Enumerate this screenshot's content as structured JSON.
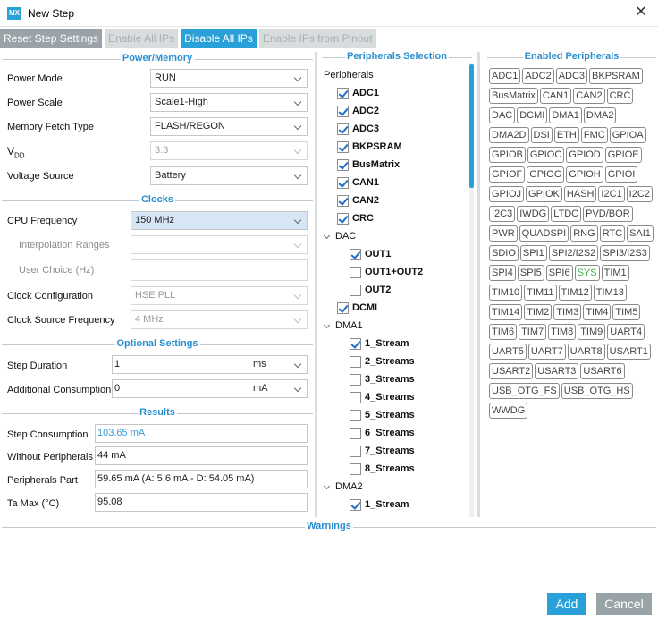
{
  "window": {
    "logo": "MX",
    "title": "New Step",
    "close": "✕"
  },
  "toolbar": {
    "reset": "Reset Step Settings",
    "enable_all": "Enable All IPs",
    "disable_all": "Disable All IPs",
    "enable_pinout": "Enable IPs from Pinout"
  },
  "power_memory": {
    "title": "Power/Memory",
    "power_mode_label": "Power Mode",
    "power_mode": "RUN",
    "power_scale_label": "Power Scale",
    "power_scale": "Scale1-High",
    "memory_fetch_label": "Memory Fetch Type",
    "memory_fetch": "FLASH/REGON",
    "vdd_label": "V",
    "vdd_sub": "DD",
    "vdd": "3.3",
    "voltage_source_label": "Voltage Source",
    "voltage_source": "Battery"
  },
  "clocks": {
    "title": "Clocks",
    "cpu_freq_label": "CPU Frequency",
    "cpu_freq": "150 MHz",
    "interp_label": "Interpolation Ranges",
    "user_choice_label": "User Choice (Hz)",
    "clock_config_label": "Clock Configuration",
    "clock_config": "HSE PLL",
    "clock_source_label": "Clock Source Frequency",
    "clock_source": "4 MHz"
  },
  "optional": {
    "title": "Optional Settings",
    "step_duration_label": "Step Duration",
    "step_duration": "1",
    "step_duration_unit": "ms",
    "additional_label": "Additional Consumption",
    "additional": "0",
    "additional_unit": "mA"
  },
  "results": {
    "title": "Results",
    "step_consumption_label": "Step Consumption",
    "step_consumption": "103.65 mA",
    "without_label": "Without Peripherals",
    "without": "44 mA",
    "peripherals_part_label": "Peripherals Part",
    "peripherals_part": "59.65 mA  (A: 5.6 mA - D: 54.05 mA)",
    "ta_max_label": "Ta Max (°C)",
    "ta_max": "95.08"
  },
  "peripherals_selection": {
    "title": "Peripherals Selection",
    "root": "Peripherals",
    "items": [
      {
        "label": "ADC1",
        "checked": true
      },
      {
        "label": "ADC2",
        "checked": true
      },
      {
        "label": "ADC3",
        "checked": true
      },
      {
        "label": "BKPSRAM",
        "checked": true
      },
      {
        "label": "BusMatrix",
        "checked": true
      },
      {
        "label": "CAN1",
        "checked": true
      },
      {
        "label": "CAN2",
        "checked": true
      },
      {
        "label": "CRC",
        "checked": true
      }
    ],
    "dac": {
      "label": "DAC",
      "items": [
        {
          "label": "OUT1",
          "checked": true
        },
        {
          "label": "OUT1+OUT2",
          "checked": false
        },
        {
          "label": "OUT2",
          "checked": false
        }
      ]
    },
    "dcmi": {
      "label": "DCMI",
      "checked": true
    },
    "dma1": {
      "label": "DMA1",
      "items": [
        {
          "label": "1_Stream",
          "checked": true
        },
        {
          "label": "2_Streams",
          "checked": false
        },
        {
          "label": "3_Streams",
          "checked": false
        },
        {
          "label": "4_Streams",
          "checked": false
        },
        {
          "label": "5_Streams",
          "checked": false
        },
        {
          "label": "6_Streams",
          "checked": false
        },
        {
          "label": "7_Streams",
          "checked": false
        },
        {
          "label": "8_Streams",
          "checked": false
        }
      ]
    },
    "dma2": {
      "label": "DMA2",
      "items": [
        {
          "label": "1_Stream",
          "checked": true
        }
      ]
    }
  },
  "enabled_peripherals": {
    "title": "Enabled Peripherals",
    "chips": [
      "ADC1",
      "ADC2",
      "ADC3",
      "BKPSRAM",
      "BusMatrix",
      "CAN1",
      "CAN2",
      "CRC",
      "DAC",
      "DCMI",
      "DMA1",
      "DMA2",
      "DMA2D",
      "DSI",
      "ETH",
      "FMC",
      "GPIOA",
      "GPIOB",
      "GPIOC",
      "GPIOD",
      "GPIOE",
      "GPIOF",
      "GPIOG",
      "GPIOH",
      "GPIOI",
      "GPIOJ",
      "GPIOK",
      "HASH",
      "I2C1",
      "I2C2",
      "I2C3",
      "IWDG",
      "LTDC",
      "PVD/BOR",
      "PWR",
      "QUADSPI",
      "RNG",
      "RTC",
      "SAI1",
      "SDIO",
      "SPI1",
      "SPI2/I2S2",
      "SPI3/I2S3",
      "SPI4",
      "SPI5",
      "SPI6",
      "SYS",
      "TIM1",
      "TIM10",
      "TIM11",
      "TIM12",
      "TIM13",
      "TIM14",
      "TIM2",
      "TIM3",
      "TIM4",
      "TIM5",
      "TIM6",
      "TIM7",
      "TIM8",
      "TIM9",
      "UART4",
      "UART5",
      "UART7",
      "UART8",
      "USART1",
      "USART2",
      "USART3",
      "USART6",
      "USB_OTG_FS",
      "USB_OTG_HS",
      "WWDG"
    ],
    "highlight_color": "#3db04a",
    "highlighted": "SYS"
  },
  "warnings": {
    "title": "Warnings"
  },
  "buttons": {
    "add": "Add",
    "cancel": "Cancel"
  },
  "colors": {
    "accent": "#2aa0d9",
    "gray_button": "#9aa3a7"
  }
}
